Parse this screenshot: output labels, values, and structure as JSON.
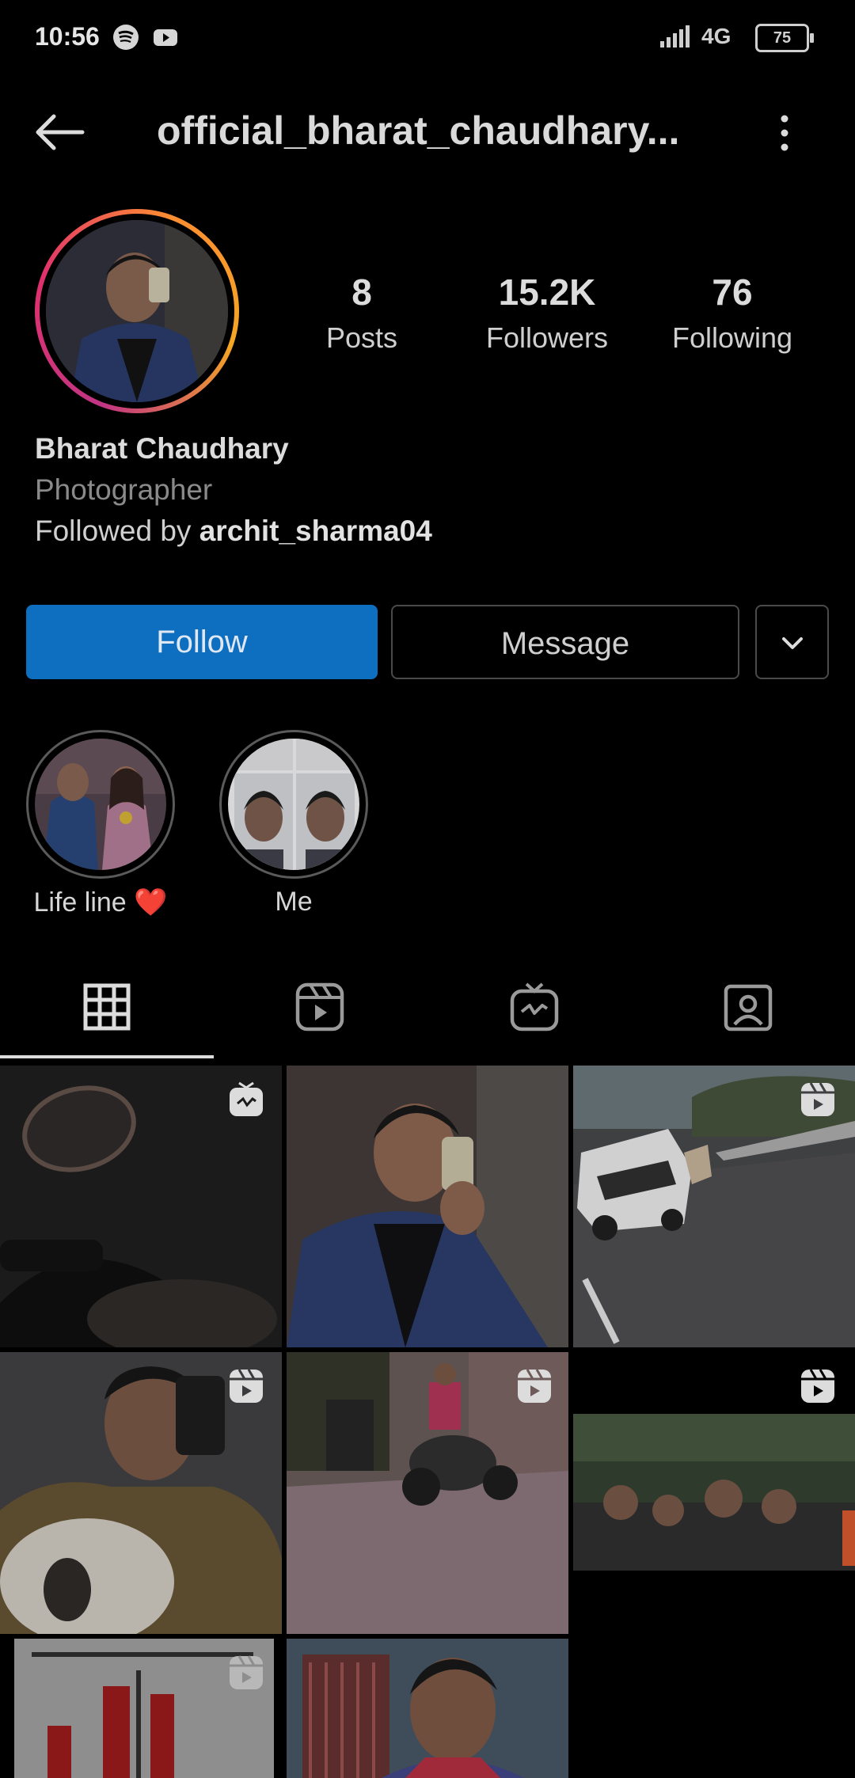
{
  "status_bar": {
    "time": "10:56",
    "network": "4G",
    "battery": "75"
  },
  "header": {
    "title": "official_bharat_chaudhary..."
  },
  "profile": {
    "stats": [
      {
        "value": "8",
        "label": "Posts"
      },
      {
        "value": "15.2K",
        "label": "Followers"
      },
      {
        "value": "76",
        "label": "Following"
      }
    ],
    "name": "Bharat Chaudhary",
    "category": "Photographer",
    "followed_by_prefix": "Followed by ",
    "followed_by_user": "archit_sharma04"
  },
  "actions": {
    "follow_label": "Follow",
    "message_label": "Message"
  },
  "highlights": [
    {
      "label": "Life line ❤️"
    },
    {
      "label": "Me"
    }
  ],
  "tabs": [
    "posts-grid",
    "reels",
    "igtv",
    "tagged"
  ],
  "grid": {
    "tiles": [
      {
        "badge": "igtv-icon"
      },
      {
        "badge": ""
      },
      {
        "badge": "reels-icon"
      },
      {
        "badge": "reels-icon"
      },
      {
        "badge": "reels-icon"
      },
      {
        "badge": "reels-icon"
      },
      {
        "badge": "reels-icon"
      },
      {
        "badge": ""
      }
    ]
  },
  "colors": {
    "follow_button": "#0e6ebf",
    "background": "#000000",
    "story_ring": "#e1306c"
  }
}
